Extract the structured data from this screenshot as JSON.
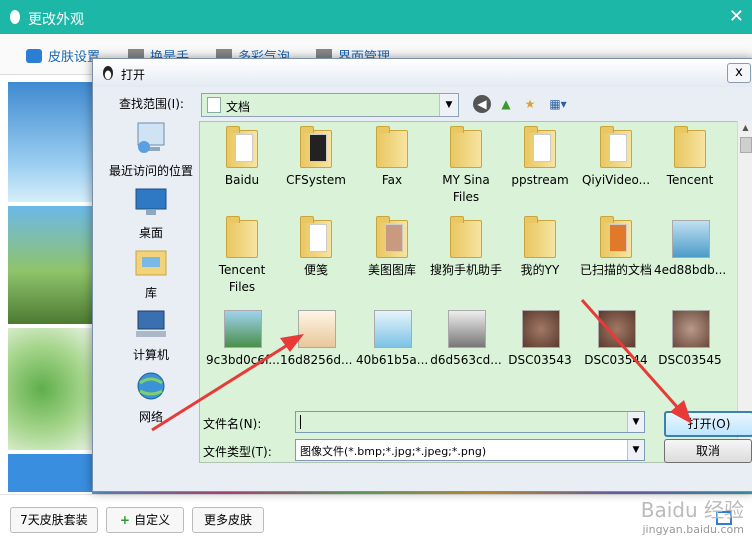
{
  "back_window": {
    "title": "更改外观",
    "tabs": [
      "皮肤设置",
      "换是手",
      "多彩气泡",
      "界面管理"
    ],
    "buttons": [
      "7天皮肤套装",
      "自定义",
      "更多皮肤"
    ]
  },
  "dialog": {
    "title": "打开",
    "look_in_label": "查找范围(I):",
    "look_in_value": "文档",
    "places": [
      {
        "label": "最近访问的位置",
        "icon": "recent-places-icon"
      },
      {
        "label": "桌面",
        "icon": "desktop-icon"
      },
      {
        "label": "库",
        "icon": "library-icon"
      },
      {
        "label": "计算机",
        "icon": "computer-icon"
      },
      {
        "label": "网络",
        "icon": "network-icon"
      }
    ],
    "items": [
      {
        "name": "Baidu",
        "kind": "folder"
      },
      {
        "name": "CFSystem",
        "kind": "folder"
      },
      {
        "name": "Fax",
        "kind": "folder"
      },
      {
        "name": "MY Sina Files",
        "kind": "folder"
      },
      {
        "name": "ppstream",
        "kind": "folder"
      },
      {
        "name": "QiyiVideo...",
        "kind": "folder"
      },
      {
        "name": "Tencent",
        "kind": "folder"
      },
      {
        "name": "Tencent Files",
        "kind": "folder"
      },
      {
        "name": "便笺",
        "kind": "folder"
      },
      {
        "name": "美图图库",
        "kind": "folder"
      },
      {
        "name": "搜狗手机助手",
        "kind": "folder"
      },
      {
        "name": "我的YY",
        "kind": "folder"
      },
      {
        "name": "已扫描的文档",
        "kind": "folder"
      },
      {
        "name": "4ed88bdb...",
        "kind": "image"
      },
      {
        "name": "9c3bd0c6f...",
        "kind": "image"
      },
      {
        "name": "16d8256d...",
        "kind": "image"
      },
      {
        "name": "40b61b5a...",
        "kind": "image"
      },
      {
        "name": "d6d563cd...",
        "kind": "image"
      },
      {
        "name": "DSC03543",
        "kind": "image"
      },
      {
        "name": "DSC03544",
        "kind": "image"
      },
      {
        "name": "DSC03545",
        "kind": "image"
      }
    ],
    "file_name_label": "文件名(N):",
    "file_name_value": "",
    "file_type_label": "文件类型(T):",
    "file_type_value": "图像文件(*.bmp;*.jpg;*.jpeg;*.png)",
    "open_button": "打开(O)",
    "cancel_button": "取消",
    "close_glyph": "x"
  },
  "watermark": {
    "line1": "Baidu 经验",
    "line2": "jingyan.baidu.com"
  },
  "colors": {
    "accent": "#1db7a8",
    "view_bg": "#d9f2d8",
    "arrow": "#e83a36"
  }
}
